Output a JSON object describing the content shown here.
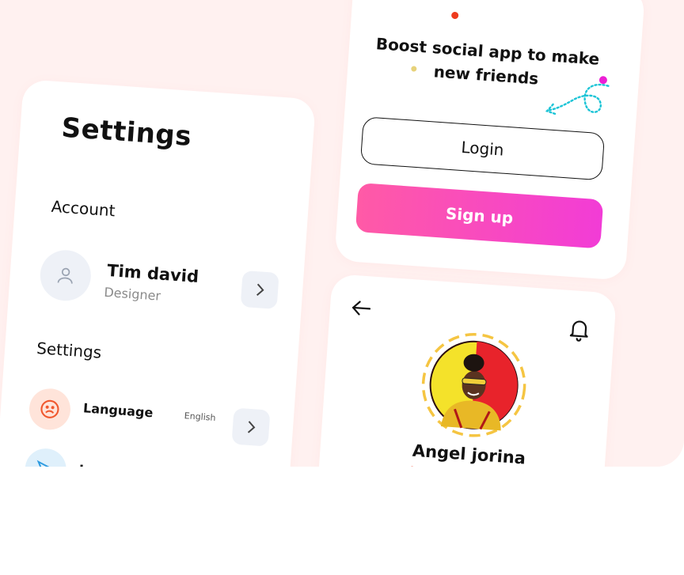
{
  "settings_screen": {
    "title": "Settings",
    "account_section": "Account",
    "user": {
      "name": "Tim david",
      "role": "Designer"
    },
    "settings_section": "Settings",
    "language": {
      "label": "Language",
      "value": "English"
    },
    "notification": {
      "label": "I"
    }
  },
  "login_screen": {
    "headline": "Boost social app to make new friends",
    "login_label": "Login",
    "signup_label": "Sign up",
    "accent_gradient": [
      "#ff5aa6",
      "#f23cd6"
    ]
  },
  "profile_screen": {
    "name": "Angel jorina"
  },
  "colors": {
    "background": "#fff1f0",
    "card": "#ffffff",
    "accent_red": "#ee3b1e",
    "accent_magenta": "#ec1fd4",
    "ring_yellow": "#f5c542"
  }
}
